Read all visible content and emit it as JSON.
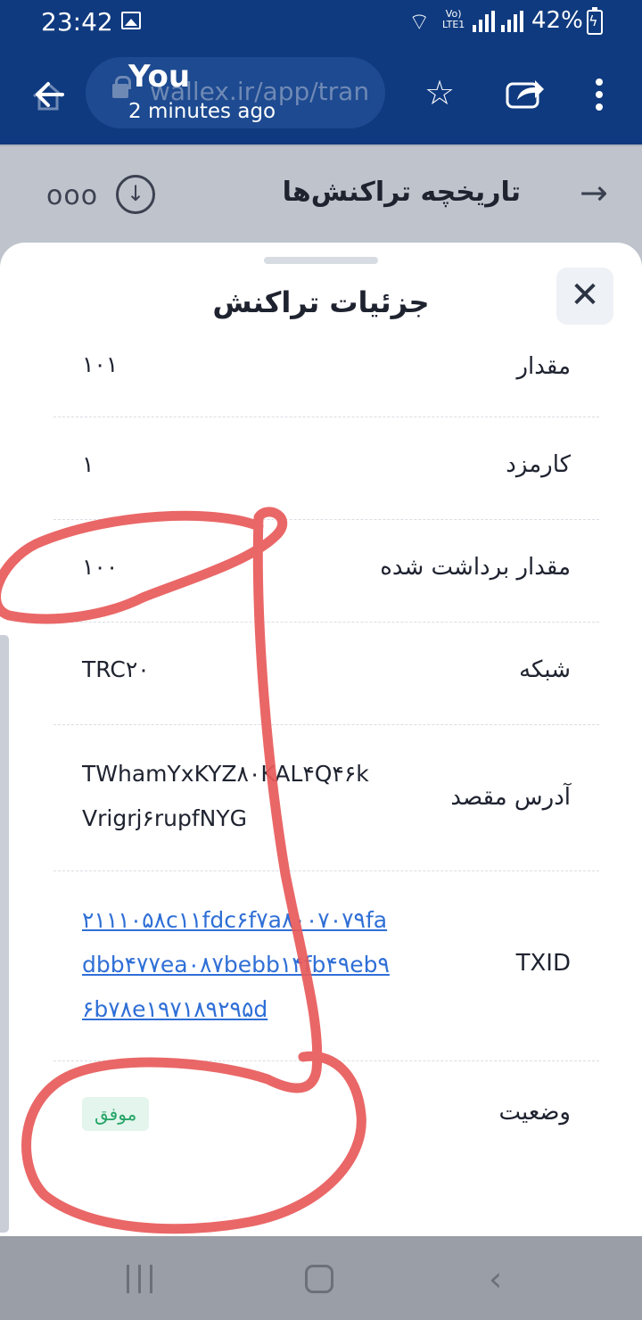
{
  "status_bar": {
    "time": "23:42",
    "network_label": "Vo)\nLTE1",
    "battery": "42%"
  },
  "browser": {
    "url": "wallex.ir/app/tran",
    "notification_title": "You",
    "notification_subtitle": "2 minutes ago"
  },
  "page_header": {
    "title": "تاریخچه تراکنش‌ها",
    "more_label": "ooo"
  },
  "sheet": {
    "title": "جزئیات تراکنش",
    "close_label": "✕",
    "rows": [
      {
        "label": "مقدار",
        "value": "۱۰۱"
      },
      {
        "label": "کارمزد",
        "value": "۱"
      },
      {
        "label": "مقدار برداشت شده",
        "value": "۱۰۰"
      },
      {
        "label": "شبکه",
        "value": "TRC۲۰"
      },
      {
        "label": "آدرس مقصد",
        "value_lines": [
          "TWhamYxKYZ۸۰KAL۴Q۴۶k",
          "Vrigrj۶rupfNYG"
        ]
      },
      {
        "label": "TXID",
        "value_lines": [
          "۲۱۱۱۰۵۸c۱۱fdc۶f۷a۸۰۰۷۰۷۹fa",
          "dbb۴۷۷ea۰۸۷bebb۱۴fb۴۹eb۹",
          "۶b۷۸e۱۹۷۱۸۹۲۹۵d"
        ]
      },
      {
        "label": "وضعیت",
        "badge": "موفق"
      }
    ]
  },
  "colors": {
    "header_bg": "#0f3a7f",
    "link": "#2f6fd6",
    "success_bg": "#e3f5ec",
    "success_text": "#23a466",
    "annotation": "#e85a5a"
  }
}
